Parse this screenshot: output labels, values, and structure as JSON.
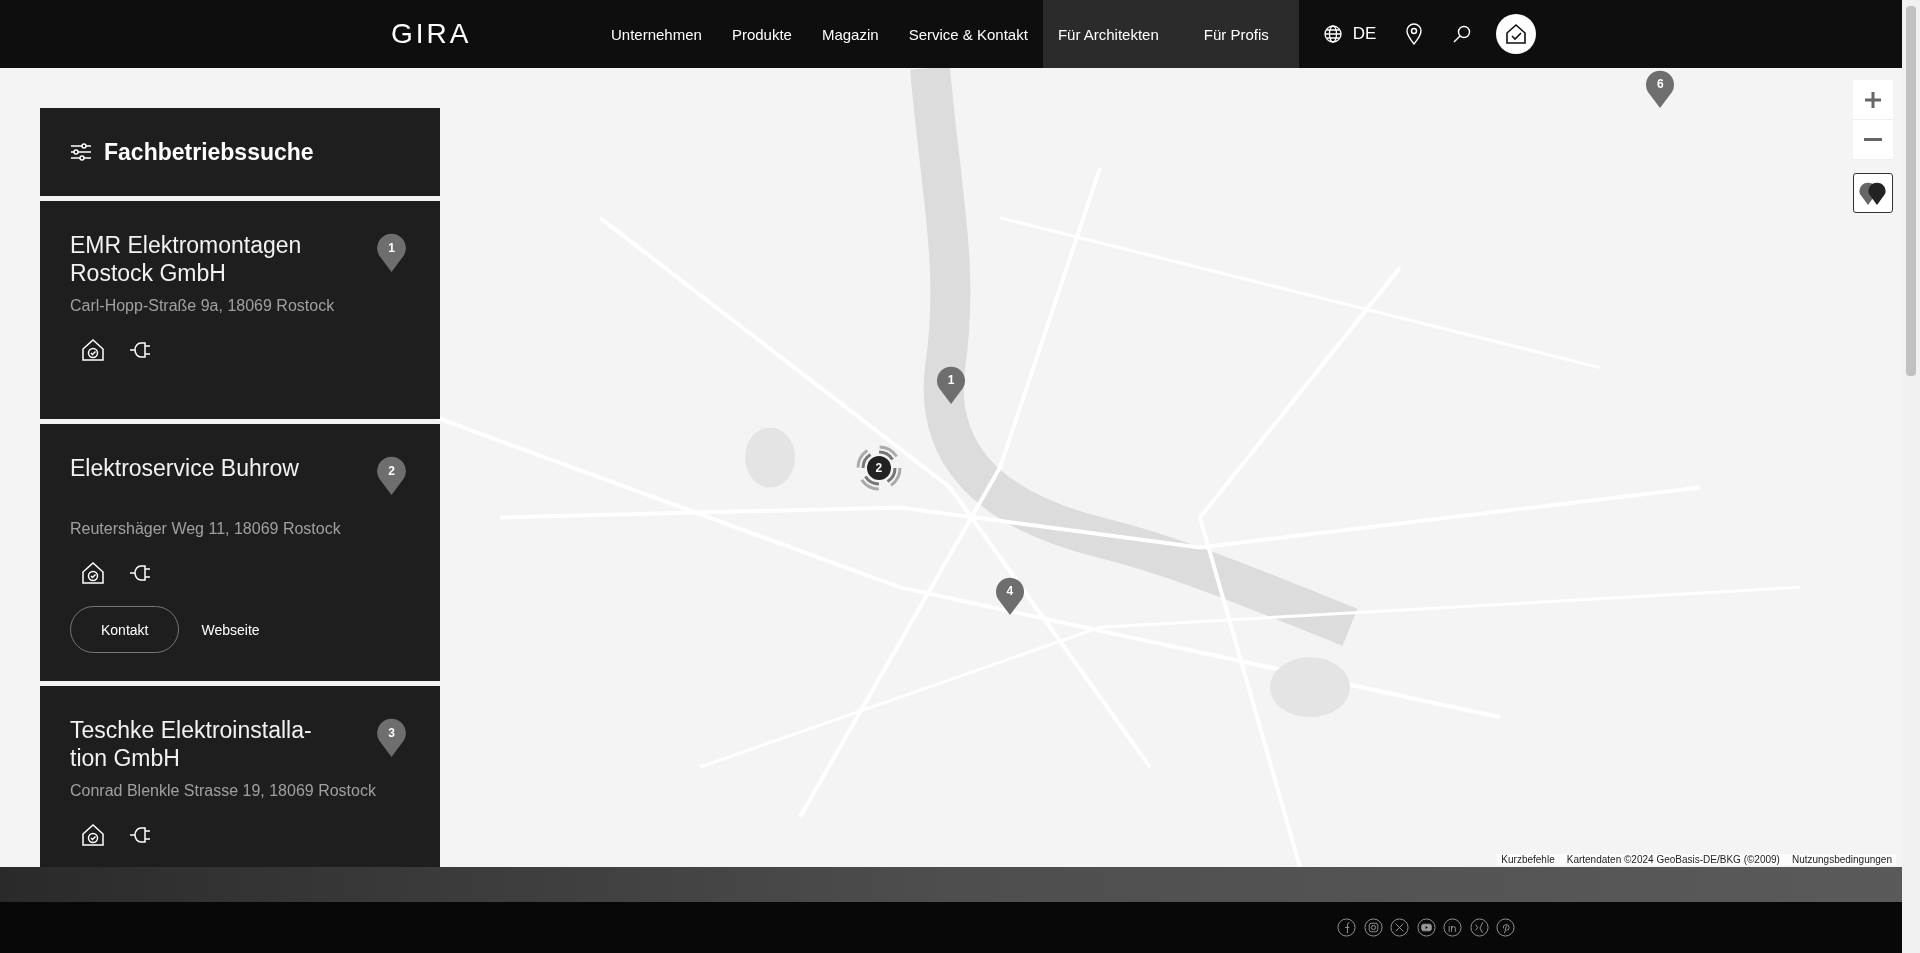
{
  "header": {
    "logo": "GIRA",
    "nav": [
      {
        "label": "Unternehmen",
        "highlighted": false
      },
      {
        "label": "Produkte",
        "highlighted": false
      },
      {
        "label": "Magazin",
        "highlighted": false
      },
      {
        "label": "Service & Kontakt",
        "highlighted": false
      },
      {
        "label": "Für Architekten",
        "highlighted": true
      },
      {
        "label": "Für Profis",
        "highlighted": true
      }
    ],
    "language": "DE"
  },
  "sidebar": {
    "title": "Fachbetriebssuche",
    "results": [
      {
        "name": "EMR Elektromontagen Rostock GmbH",
        "address": "Carl-Hopp-Straße 9a, 18069 Rostock",
        "pin": "1"
      },
      {
        "name": "Elektroservice Buhrow",
        "address": "Reutershäger Weg 11, 18069 Rostock",
        "pin": "2",
        "buttons": [
          {
            "label": "Kontakt",
            "kind": "outline"
          },
          {
            "label": "Webseite",
            "kind": "link"
          }
        ]
      },
      {
        "name": "Teschke Elektroinstalla-tion GmbH",
        "address": "Conrad Blenkle Strasse 19, 18069 Rostock",
        "pin": "3"
      }
    ]
  },
  "map": {
    "markers": [
      {
        "label": "1",
        "kind": "pin"
      },
      {
        "label": "2",
        "kind": "cluster"
      },
      {
        "label": "4",
        "kind": "pin"
      },
      {
        "label": "6",
        "kind": "pin"
      }
    ],
    "attribution": [
      "Kurzbefehle",
      "Kartendaten ©2024 GeoBasis-DE/BKG (©2009)",
      "Nutzungsbedingungen"
    ]
  }
}
